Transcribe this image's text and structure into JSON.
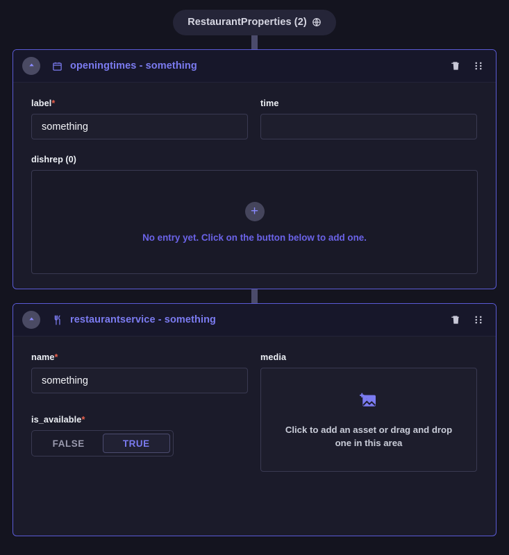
{
  "root": {
    "label": "RestaurantProperties (2)",
    "icon": "globe-icon"
  },
  "cards": [
    {
      "title": "openingtimes - something",
      "icon": "calendar-icon",
      "collapse_icon": "chevron-up-icon",
      "delete_icon": "trash-icon",
      "drag_icon": "drag-handle-icon",
      "fields": {
        "label": {
          "label": "label",
          "required": "*",
          "value": "something",
          "placeholder": ""
        },
        "time": {
          "label": "time",
          "required": "",
          "value": "",
          "placeholder": ""
        }
      },
      "repeatable": {
        "label": "dishrep (0)",
        "empty_message": "No entry yet. Click on the button below to add one.",
        "add_icon": "plus-icon"
      }
    },
    {
      "title": "restaurantservice - something",
      "icon": "cutlery-icon",
      "collapse_icon": "chevron-up-icon",
      "delete_icon": "trash-icon",
      "drag_icon": "drag-handle-icon",
      "fields": {
        "name": {
          "label": "name",
          "required": "*",
          "value": "something",
          "placeholder": ""
        },
        "media": {
          "label": "media",
          "required": "",
          "drop_message": "Click to add an asset or drag and drop one in this area",
          "icon": "add-image-icon"
        },
        "is_available": {
          "label": "is_available",
          "required": "*",
          "options": [
            "FALSE",
            "TRUE"
          ],
          "selected": "TRUE"
        }
      }
    }
  ],
  "colors": {
    "background": "#14141f",
    "card_border": "#5b5bd6",
    "accent": "#7b7bf0",
    "required": "#e8604c",
    "connector": "#4b4b6b"
  }
}
